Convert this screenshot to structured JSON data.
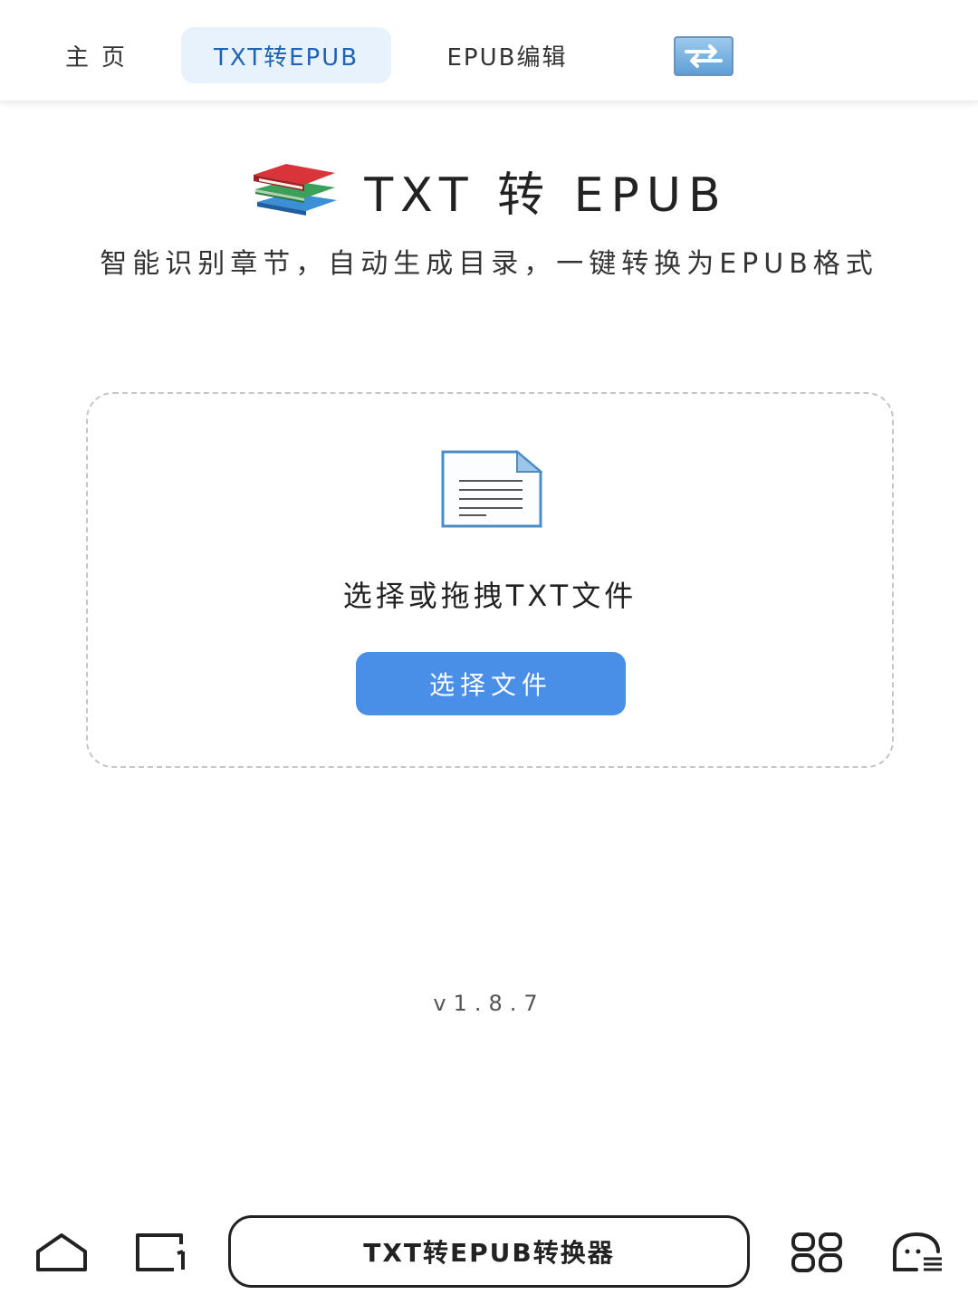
{
  "nav": {
    "home": "主页",
    "txt_to_epub": "TXT转EPUB",
    "epub_edit": "EPUB编辑",
    "switch_icon": "swap-arrows-icon"
  },
  "header": {
    "title": "TXT 转 EPUB",
    "subtitle": "智能识别章节，自动生成目录，一键转换为EPUB格式",
    "icon": "books-icon"
  },
  "dropzone": {
    "label": "选择或拖拽TXT文件",
    "button": "选择文件",
    "icon": "document-icon"
  },
  "version": "v1.8.7",
  "bottom_bar": {
    "title": "TXT转EPUB转换器",
    "icons": [
      "home-icon",
      "tabs-icon",
      "apps-icon",
      "assistant-icon"
    ]
  },
  "colors": {
    "accent": "#4a8fe7",
    "active_tab_bg": "#e7f2fd",
    "active_tab_text": "#1e63b8"
  }
}
